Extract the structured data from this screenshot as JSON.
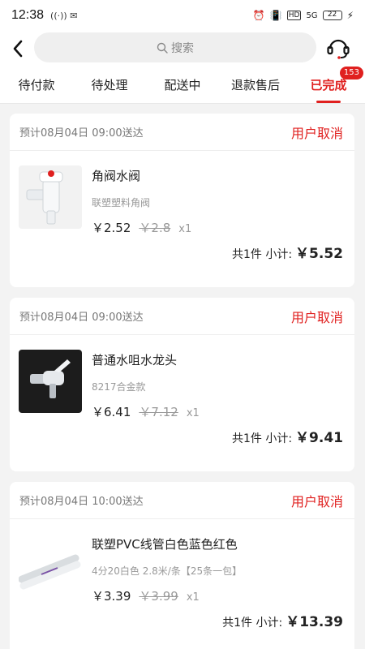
{
  "status_bar": {
    "time": "12:38",
    "left_icons": "((·))  ✉",
    "hd": "HD",
    "signal": "5G",
    "battery": "22"
  },
  "header": {
    "search_placeholder": "搜索"
  },
  "tabs": [
    {
      "label": "待付款"
    },
    {
      "label": "待处理"
    },
    {
      "label": "配送中"
    },
    {
      "label": "退款售后"
    },
    {
      "label": "已完成",
      "badge": "153"
    }
  ],
  "orders": [
    {
      "eta": "预计08月04日 09:00送达",
      "status": "用户取消",
      "product": {
        "name": "角阀水阀",
        "spec": "联塑塑料角阀",
        "price": "￥2.52",
        "original_price": "￥2.8",
        "qty": "x1"
      },
      "count_label": "共1件 小计:",
      "subtotal": "￥5.52"
    },
    {
      "eta": "预计08月04日 09:00送达",
      "status": "用户取消",
      "product": {
        "name": "普通水咀水龙头",
        "spec": "8217合金款",
        "price": "￥6.41",
        "original_price": "￥7.12",
        "qty": "x1"
      },
      "count_label": "共1件 小计:",
      "subtotal": "￥9.41"
    },
    {
      "eta": "预计08月04日 10:00送达",
      "status": "用户取消",
      "product": {
        "name": "联塑PVC线管白色蓝色红色",
        "spec": "4分20白色 2.8米/条【25条一包】",
        "price": "￥3.39",
        "original_price": "￥3.99",
        "qty": "x1"
      },
      "count_label": "共1件 小计:",
      "subtotal": "￥13.39"
    }
  ],
  "colors": {
    "accent": "#e0201f",
    "background": "#f3f3f3"
  }
}
